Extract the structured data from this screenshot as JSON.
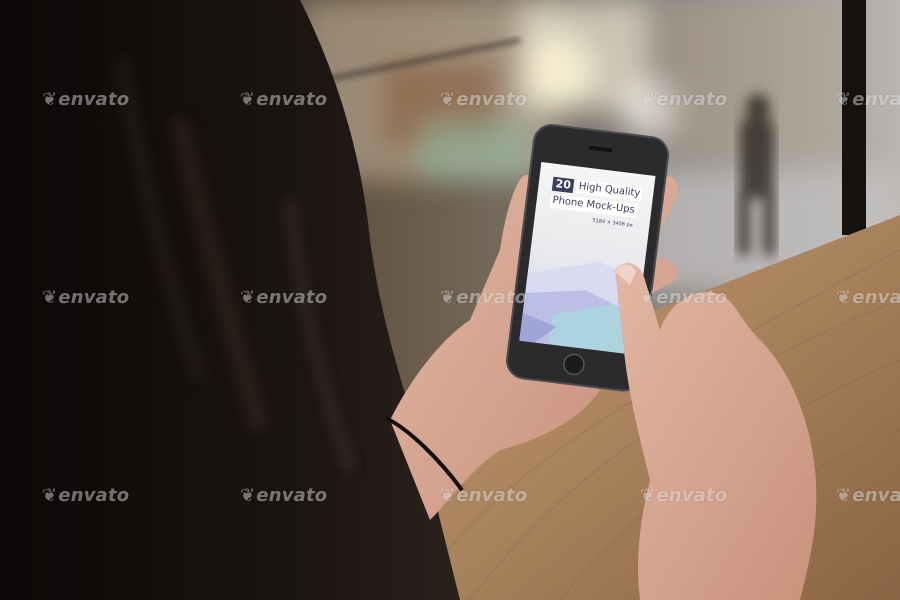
{
  "phone_screen": {
    "count": "20",
    "headline_1": "High Quality",
    "headline_2": "Phone Mock-Ups",
    "resolution": "5184 × 3456 px"
  },
  "watermark": {
    "text": "envato",
    "icon": "envato-leaf-icon"
  },
  "colors": {
    "screen_accent": "#3b3f5c",
    "wood": "#a9835f",
    "phone_body": "#2b2b2e"
  }
}
